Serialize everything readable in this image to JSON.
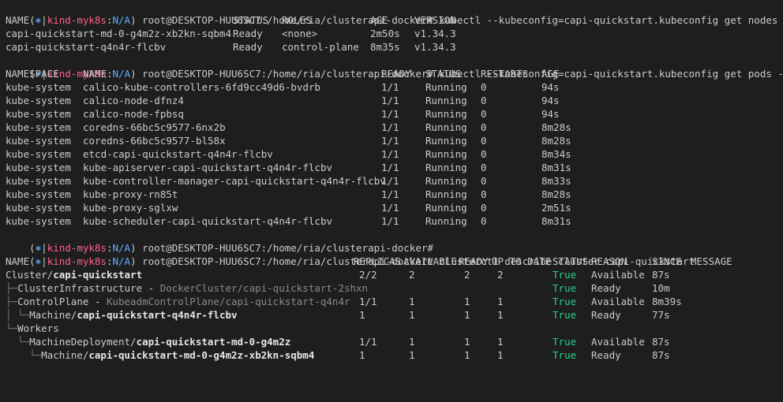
{
  "colors": {
    "background": "#1e1e1e",
    "text": "#cccccc",
    "prompt_kind": "#ff5f87",
    "prompt_na": "#5fb0ff",
    "status_true": "#23d18b"
  },
  "prompt": {
    "open": "(",
    "star": "⎈",
    "sep": "|",
    "context": "kind-myk8s",
    "colon": ":",
    "ns": "N/A",
    "close": ")",
    "path": " root@DESKTOP-HUU6SC7:/home/ria/clusterapi-docker#"
  },
  "commands": {
    "get_nodes": " kubectl --kubeconfig=capi-quickstart.kubeconfig get nodes -A",
    "get_pods": " kubectl --kubeconfig=capi-quickstart.kubeconfig get pods -A",
    "empty": "",
    "describe": " clusterctl describe cluster capi-quickstart"
  },
  "nodes": {
    "headers": [
      "NAME",
      "STATUS",
      "ROLES",
      "AGE",
      "VERSION"
    ],
    "rows": [
      [
        "capi-quickstart-md-0-g4m2z-xb2kn-sqbm4",
        "Ready",
        "<none>",
        "2m50s",
        "v1.34.3"
      ],
      [
        "capi-quickstart-q4n4r-flcbv",
        "Ready",
        "control-plane",
        "8m35s",
        "v1.34.3"
      ]
    ]
  },
  "pods": {
    "headers": [
      "NAMESPACE",
      "NAME",
      "READY",
      "STATUS",
      "RESTARTS",
      "AGE"
    ],
    "rows": [
      [
        "kube-system",
        "calico-kube-controllers-6fd9cc49d6-bvdrb",
        "1/1",
        "Running",
        "0",
        "94s"
      ],
      [
        "kube-system",
        "calico-node-dfnz4",
        "1/1",
        "Running",
        "0",
        "94s"
      ],
      [
        "kube-system",
        "calico-node-fpbsq",
        "1/1",
        "Running",
        "0",
        "94s"
      ],
      [
        "kube-system",
        "coredns-66bc5c9577-6nx2b",
        "1/1",
        "Running",
        "0",
        "8m28s"
      ],
      [
        "kube-system",
        "coredns-66bc5c9577-bl58x",
        "1/1",
        "Running",
        "0",
        "8m28s"
      ],
      [
        "kube-system",
        "etcd-capi-quickstart-q4n4r-flcbv",
        "1/1",
        "Running",
        "0",
        "8m34s"
      ],
      [
        "kube-system",
        "kube-apiserver-capi-quickstart-q4n4r-flcbv",
        "1/1",
        "Running",
        "0",
        "8m31s"
      ],
      [
        "kube-system",
        "kube-controller-manager-capi-quickstart-q4n4r-flcbv",
        "1/1",
        "Running",
        "0",
        "8m33s"
      ],
      [
        "kube-system",
        "kube-proxy-rn85t",
        "1/1",
        "Running",
        "0",
        "8m28s"
      ],
      [
        "kube-system",
        "kube-proxy-sglxw",
        "1/1",
        "Running",
        "0",
        "2m51s"
      ],
      [
        "kube-system",
        "kube-scheduler-capi-quickstart-q4n4r-flcbv",
        "1/1",
        "Running",
        "0",
        "8m31s"
      ]
    ]
  },
  "cluster": {
    "headers": [
      "NAME",
      "REPLICAS",
      "AVAILABLE",
      "READY",
      "UP TO DATE",
      "STATUS",
      "REASON",
      "SINCE",
      "MESSAGE"
    ],
    "rows": [
      {
        "tree": "",
        "kind": "Cluster/",
        "name": "capi-quickstart",
        "replicas": "2/2",
        "available": "2",
        "ready": "2",
        "uptodate": "2",
        "status": "True",
        "reason": "Available",
        "since": "87s"
      },
      {
        "tree": "├─",
        "kind": "ClusterInfrastructure - ",
        "name": "DockerCluster/capi-quickstart-2shxn",
        "replicas": "",
        "available": "",
        "ready": "",
        "uptodate": "",
        "status": "True",
        "reason": "Ready",
        "since": "10m"
      },
      {
        "tree": "├─",
        "kind": "ControlPlane - ",
        "name": "KubeadmControlPlane/capi-quickstart-q4n4r",
        "replicas": "1/1",
        "available": "1",
        "ready": "1",
        "uptodate": "1",
        "status": "True",
        "reason": "Available",
        "since": "8m39s"
      },
      {
        "tree": "│ └─",
        "kind": "Machine/",
        "name": "capi-quickstart-q4n4r-flcbv",
        "replicas": "1",
        "available": "1",
        "ready": "1",
        "uptodate": "1",
        "status": "True",
        "reason": "Ready",
        "since": "77s"
      },
      {
        "tree": "└─",
        "kind": "Workers",
        "name": "",
        "replicas": "",
        "available": "",
        "ready": "",
        "uptodate": "",
        "status": "",
        "reason": "",
        "since": ""
      },
      {
        "tree": "  └─",
        "kind": "MachineDeployment/",
        "name": "capi-quickstart-md-0-g4m2z",
        "replicas": "1/1",
        "available": "1",
        "ready": "1",
        "uptodate": "1",
        "status": "True",
        "reason": "Available",
        "since": "87s"
      },
      {
        "tree": "    └─",
        "kind": "Machine/",
        "name": "capi-quickstart-md-0-g4m2z-xb2kn-sqbm4",
        "replicas": "1",
        "available": "1",
        "ready": "1",
        "uptodate": "1",
        "status": "True",
        "reason": "Ready",
        "since": "87s"
      }
    ]
  }
}
